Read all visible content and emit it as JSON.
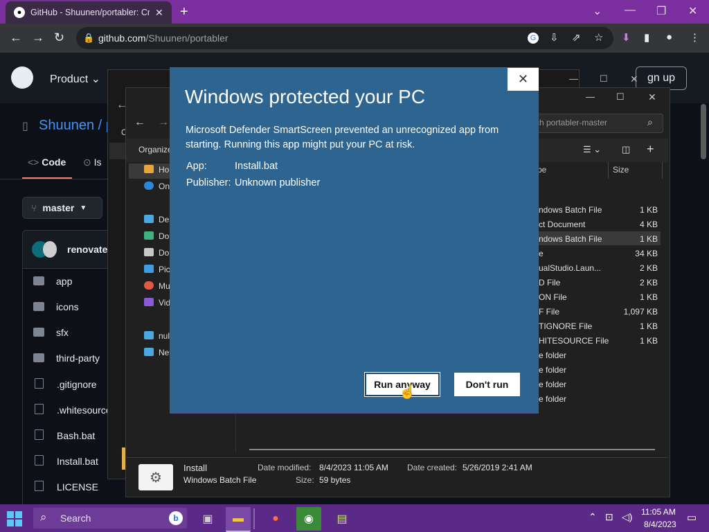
{
  "browser": {
    "tab_title": "GitHub - Shuunen/portabler: Cre",
    "url_host": "github.com",
    "url_path": "/Shuunen/portabler"
  },
  "github": {
    "nav_product": "Product",
    "sign_up": "gn up",
    "repo_owner": "Shuunen",
    "repo_sep": "/ p",
    "tab_code": "Code",
    "tab_issues": "Is",
    "branch": "master",
    "commit_user": "renovate-",
    "files": [
      "app",
      "icons",
      "sfx",
      "third-party",
      ".gitignore",
      ".whitesource",
      "Bash.bat",
      "Install.bat",
      "LICENSE"
    ]
  },
  "explorer": {
    "search_placeholder": "rch portabler-master",
    "organize": "Organize",
    "back_label": "O",
    "col_type": "pe",
    "col_size": "Size",
    "nav": [
      {
        "label": "Ho",
        "color": "#e8a33d"
      },
      {
        "label": "On",
        "color": "#2b88d8"
      },
      {
        "label": "Des",
        "color": "#4aa8e0"
      },
      {
        "label": "Do",
        "color": "#3fb27f"
      },
      {
        "label": "Do",
        "color": "#c8c8c8"
      },
      {
        "label": "Pic",
        "color": "#3e9de0"
      },
      {
        "label": "Mu",
        "color": "#e05a3f"
      },
      {
        "label": "Vid",
        "color": "#8a5ad8"
      },
      {
        "label": "nul",
        "color": "#4aa8e0"
      },
      {
        "label": "Net",
        "color": "#4aa8e0"
      }
    ],
    "rows": [
      {
        "type": "ndows Batch File",
        "size": "1 KB"
      },
      {
        "type": "ct Document",
        "size": "4 KB"
      },
      {
        "type": "ndows Batch File",
        "size": "1 KB"
      },
      {
        "type": "e",
        "size": "34 KB"
      },
      {
        "type": "ualStudio.Laun...",
        "size": "2 KB"
      },
      {
        "type": "D File",
        "size": "2 KB"
      },
      {
        "type": "ON File",
        "size": "1 KB"
      },
      {
        "type": "F File",
        "size": "1,097 KB"
      },
      {
        "type": "TIGNORE File",
        "size": "1 KB"
      },
      {
        "type": "HITESOURCE File",
        "size": "1 KB"
      },
      {
        "type": "e folder",
        "size": ""
      },
      {
        "type": "e folder",
        "size": ""
      },
      {
        "type": "e folder",
        "size": ""
      },
      {
        "type": "e folder",
        "size": ""
      }
    ],
    "details": {
      "name": "Install",
      "kind": "Windows Batch File",
      "modified_label": "Date modified:",
      "modified_value": "8/4/2023 11:05 AM",
      "created_label": "Date created:",
      "created_value": "5/26/2019 2:41 AM",
      "size_label": "Size:",
      "size_value": "59 bytes"
    }
  },
  "dialog": {
    "title": "Windows protected your PC",
    "message": "Microsoft Defender SmartScreen prevented an unrecognized app from starting. Running this app might put your PC at risk.",
    "app_label": "App:",
    "app_value": "Install.bat",
    "publisher_label": "Publisher:",
    "publisher_value": "Unknown publisher",
    "run_anyway": "Run anyway",
    "dont_run": "Don't run"
  },
  "taskbar": {
    "search_label": "Search",
    "time": "11:05 AM",
    "date": "8/4/2023"
  },
  "colors": {
    "dialog_bg": "#2e6590",
    "taskbar_bg": "#5b2a86",
    "tabstrip_bg": "#7b2f9e"
  }
}
